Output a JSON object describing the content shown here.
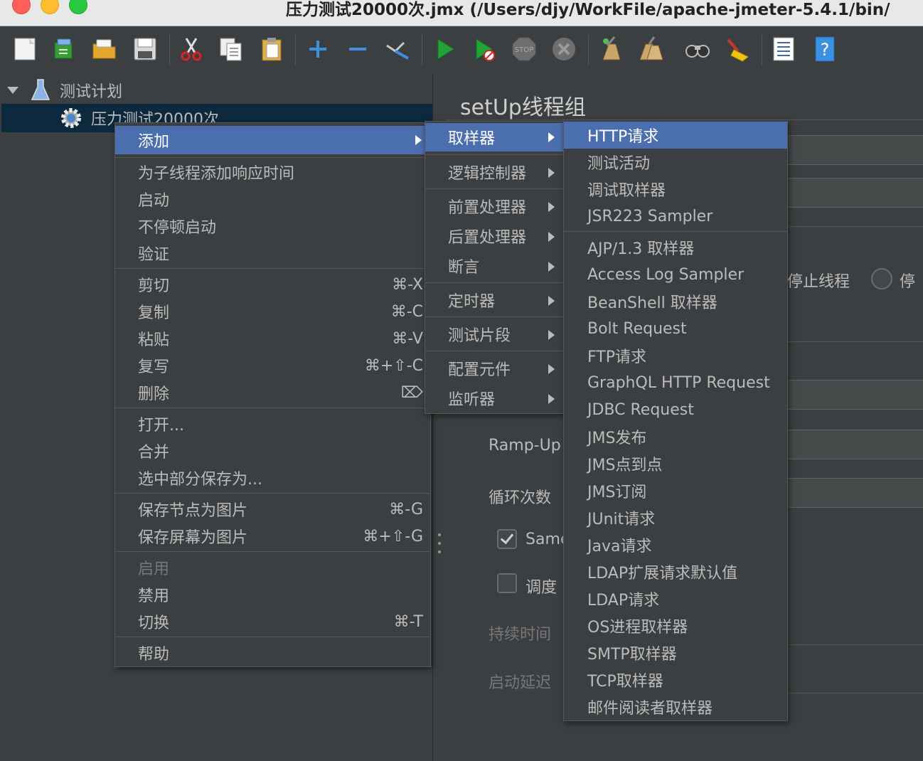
{
  "window": {
    "title": "压力测试20000次.jmx (/Users/djy/WorkFile/apache-jmeter-5.4.1/bin/"
  },
  "toolbar": {
    "buttons": [
      {
        "name": "new-icon"
      },
      {
        "name": "templates-icon"
      },
      {
        "name": "open-icon"
      },
      {
        "name": "save-icon"
      },
      {
        "name": "cut-icon"
      },
      {
        "name": "copy-icon"
      },
      {
        "name": "paste-icon"
      },
      {
        "name": "expand-all-icon"
      },
      {
        "name": "collapse-all-icon"
      },
      {
        "name": "toggle-icon"
      },
      {
        "name": "start-icon"
      },
      {
        "name": "start-no-pauses-icon"
      },
      {
        "name": "stop-icon"
      },
      {
        "name": "shutdown-icon"
      },
      {
        "name": "clear-icon"
      },
      {
        "name": "clear-all-icon"
      },
      {
        "name": "search-icon"
      },
      {
        "name": "reset-search-icon"
      },
      {
        "name": "function-helper-icon"
      },
      {
        "name": "help-icon"
      }
    ],
    "stop_label": "STOP"
  },
  "tree": {
    "root_label": "测试计划",
    "child_label": "压力测试20000次"
  },
  "panel": {
    "title": "setUp线程组",
    "stop_thread_label": "停止线程",
    "stop_partial": "停",
    "rampup_label": "Ramp-Up",
    "loop_label": "循环次数",
    "same_user_label": "Same",
    "scheduler_label": "调度",
    "duration_label": "持续时间",
    "startup_delay_label": "启动延迟"
  },
  "context_menu": {
    "add": "添加",
    "add_think_time": "为子线程添加响应时间",
    "start": "启动",
    "start_no_pauses": "不停顿启动",
    "validate": "验证",
    "cut": "剪切",
    "cut_shortcut": "⌘-X",
    "copy": "复制",
    "copy_shortcut": "⌘-C",
    "paste": "粘贴",
    "paste_shortcut": "⌘-V",
    "duplicate": "复写",
    "duplicate_shortcut": "⌘+⇧-C",
    "delete": "删除",
    "delete_shortcut": "⌦",
    "open": "打开...",
    "merge": "合并",
    "save_selection_as": "选中部分保存为...",
    "save_node_as_image": "保存节点为图片",
    "save_node_shortcut": "⌘-G",
    "save_screen_as_image": "保存屏幕为图片",
    "save_screen_shortcut": "⌘+⇧-G",
    "enable": "启用",
    "disable": "禁用",
    "toggle": "切换",
    "toggle_shortcut": "⌘-T",
    "help": "帮助"
  },
  "add_submenu": {
    "sampler": "取样器",
    "logic_controller": "逻辑控制器",
    "pre_processors": "前置处理器",
    "post_processors": "后置处理器",
    "assertions": "断言",
    "timer": "定时器",
    "test_fragment": "测试片段",
    "config_element": "配置元件",
    "listener": "监听器"
  },
  "sampler_submenu": {
    "items": [
      "HTTP请求",
      "测试活动",
      "调试取样器",
      "JSR223 Sampler",
      "AJP/1.3 取样器",
      "Access Log Sampler",
      "BeanShell 取样器",
      "Bolt Request",
      "FTP请求",
      "GraphQL HTTP Request",
      "JDBC Request",
      "JMS发布",
      "JMS点到点",
      "JMS订阅",
      "JUnit请求",
      "Java请求",
      "LDAP扩展请求默认值",
      "LDAP请求",
      "OS进程取样器",
      "SMTP取样器",
      "TCP取样器",
      "邮件阅读者取样器"
    ]
  }
}
